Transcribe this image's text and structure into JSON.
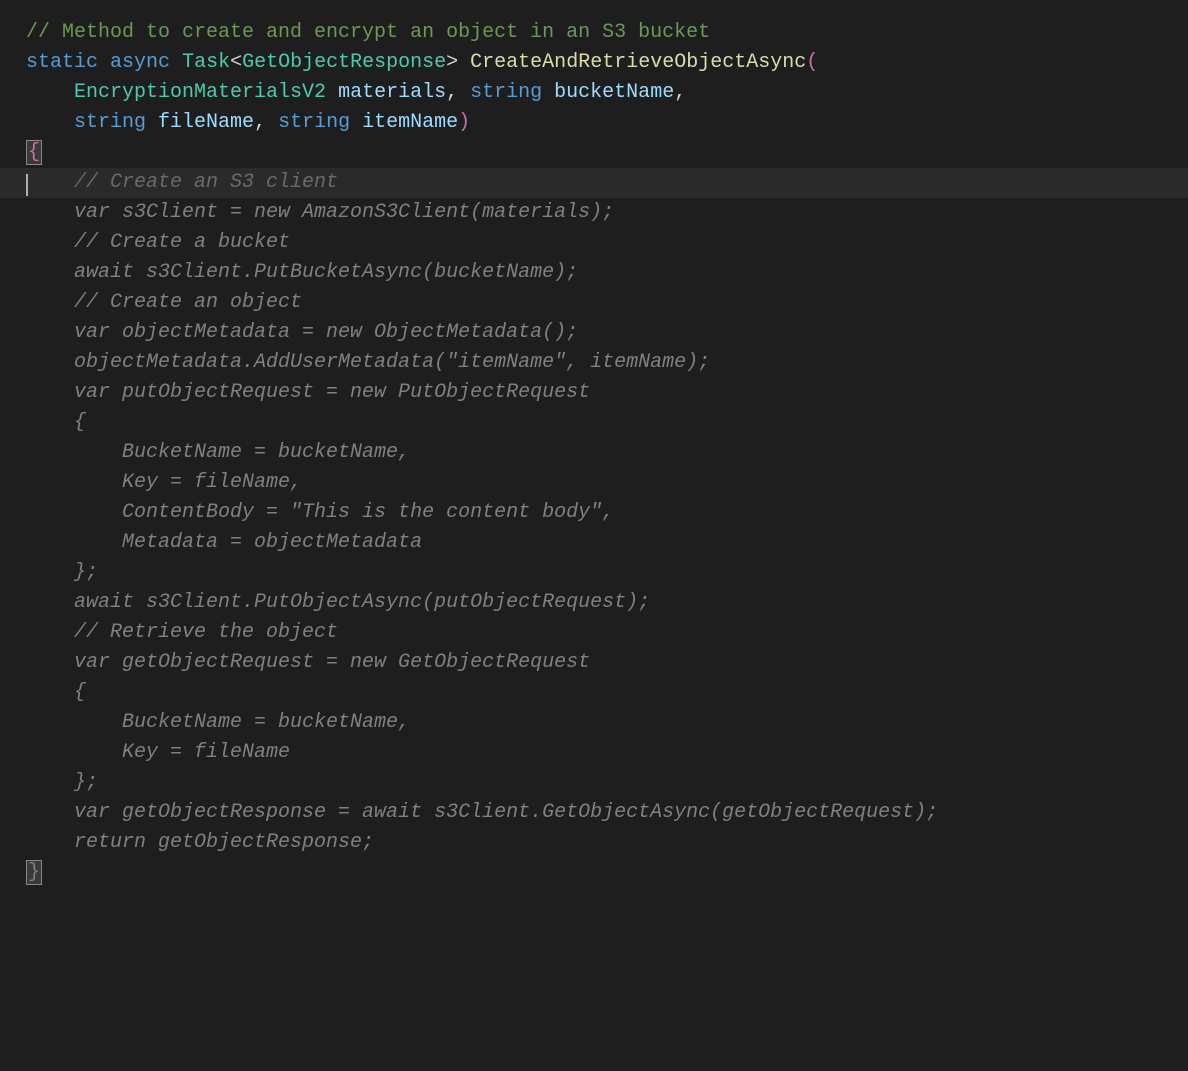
{
  "code": {
    "l1": "// Method to create and encrypt an object in an S3 bucket",
    "l2_static": "static",
    "l2_async": "async",
    "l2_task": "Task",
    "l2_lt": "<",
    "l2_resp": "GetObjectResponse",
    "l2_gt": ">",
    "l2_method": "CreateAndRetrieveObjectAsync",
    "l2_paren_o": "(",
    "l3_type": "EncryptionMaterialsV2",
    "l3_p1": "materials",
    "l3_c1": ",",
    "l3_string": "string",
    "l3_p2": "bucketName",
    "l3_c2": ",",
    "l4_string1": "string",
    "l4_p1": "fileName",
    "l4_c1": ",",
    "l4_string2": "string",
    "l4_p2": "itemName",
    "l4_paren_c": ")",
    "l5_brace": "{",
    "l6": "    // Create an S3 client",
    "l7": "    var s3Client = new AmazonS3Client(materials);",
    "l8": "",
    "l9": "    // Create a bucket",
    "l10": "    await s3Client.PutBucketAsync(bucketName);",
    "l11": "",
    "l12": "    // Create an object",
    "l13": "    var objectMetadata = new ObjectMetadata();",
    "l14": "    objectMetadata.AddUserMetadata(\"itemName\", itemName);",
    "l15": "    var putObjectRequest = new PutObjectRequest",
    "l16": "    {",
    "l17": "        BucketName = bucketName,",
    "l18": "        Key = fileName,",
    "l19": "        ContentBody = \"This is the content body\",",
    "l20": "        Metadata = objectMetadata",
    "l21": "    };",
    "l22": "    await s3Client.PutObjectAsync(putObjectRequest);",
    "l23": "",
    "l24": "    // Retrieve the object",
    "l25": "    var getObjectRequest = new GetObjectRequest",
    "l26": "    {",
    "l27": "        BucketName = bucketName,",
    "l28": "        Key = fileName",
    "l29": "    };",
    "l30": "    var getObjectResponse = await s3Client.GetObjectAsync(getObjectRequest);",
    "l31": "    return getObjectResponse;",
    "l32": "}"
  }
}
